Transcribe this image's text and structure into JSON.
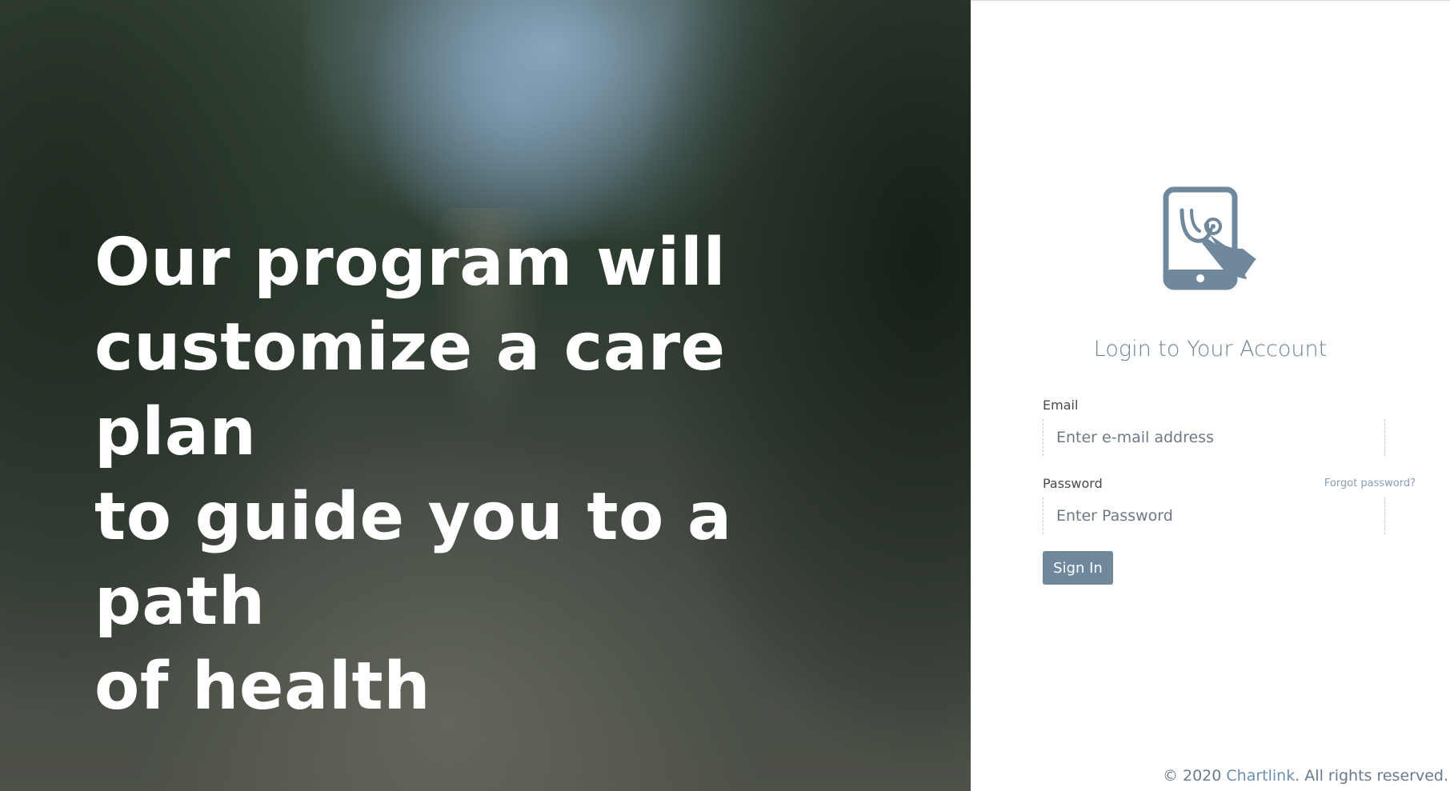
{
  "hero": {
    "headline_line1": "Our program will",
    "headline_line2": "customize a care plan",
    "headline_line3": "to guide you to a path",
    "headline_line4": "of health"
  },
  "login": {
    "icon": "tablet-stethoscope-icon",
    "title": "Login to Your Account",
    "email_label": "Email",
    "email_placeholder": "Enter e-mail address",
    "password_label": "Password",
    "forgot_link": "Forgot password?",
    "password_placeholder": "Enter Password",
    "signin_label": "Sign In"
  },
  "footer": {
    "prefix": "© 2020 ",
    "brand": "Chartlink",
    "suffix": ". All rights reserved."
  },
  "colors": {
    "accent": "#6f889c",
    "title": "#6d8396",
    "link": "#8aa0b2"
  }
}
